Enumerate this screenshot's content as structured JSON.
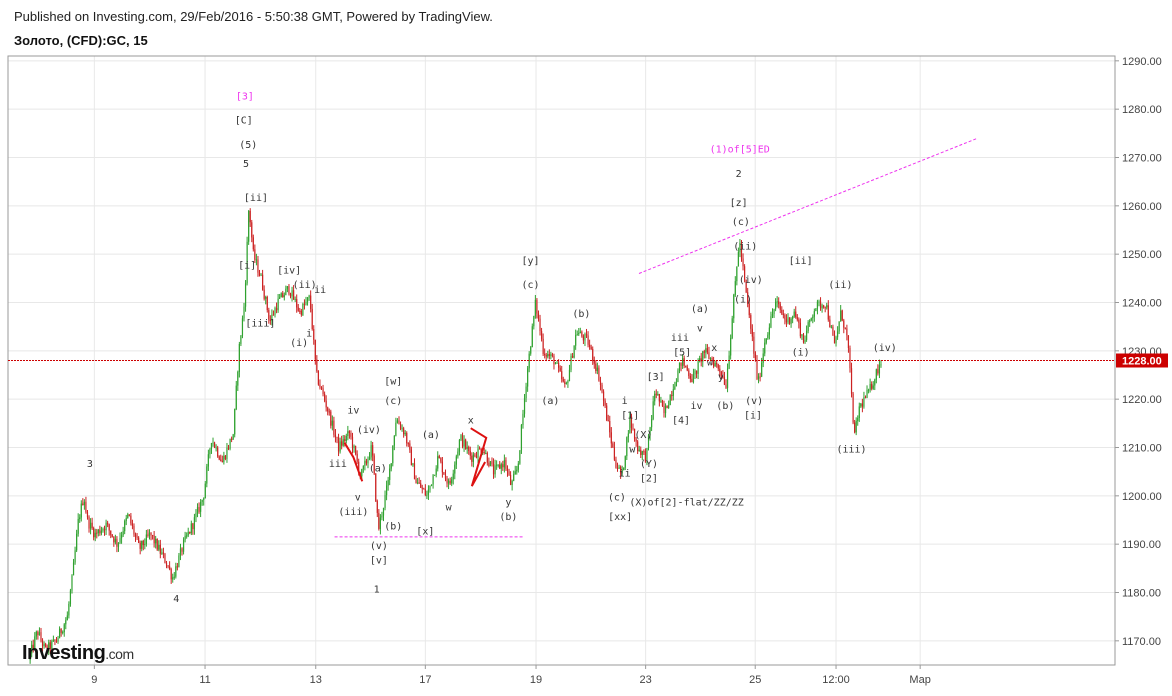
{
  "header": {
    "published": "Published on Investing.com, 29/Feb/2016 - 5:50:38 GMT, Powered by TradingView.",
    "symbol": "Золото, (CFD):GC, 15"
  },
  "logo": {
    "brand": "Investing",
    "suffix": ".com"
  },
  "colors": {
    "up": "#2fa12f",
    "down": "#cc2222",
    "price_line": "#cc0000",
    "wave_magenta": "#ee33ee",
    "grid": "#e8e8e8"
  },
  "chart_data": {
    "type": "candlestick",
    "ylim": [
      1165,
      1291
    ],
    "yticks": [
      1170,
      1180,
      1190,
      1200,
      1210,
      1220,
      1230,
      1240,
      1250,
      1260,
      1270,
      1280,
      1290
    ],
    "ytick_labels": [
      "1170.00",
      "1180.00",
      "1190.00",
      "1200.00",
      "1210.00",
      "1220.00",
      "1230.00",
      "1240.00",
      "1250.00",
      "1260.00",
      "1270.00",
      "1280.00",
      "1290.00"
    ],
    "xlim": [
      0,
      100
    ],
    "xticks": [
      7.8,
      17.8,
      27.8,
      37.7,
      47.7,
      57.6,
      67.5,
      74.8,
      82.4
    ],
    "xtick_labels": [
      "9",
      "11",
      "13",
      "17",
      "19",
      "23",
      "25",
      "12:00",
      "Мар"
    ],
    "current_price": 1228,
    "current_price_label": "1228.00",
    "price_path": [
      [
        2.0,
        1166
      ],
      [
        2.8,
        1172
      ],
      [
        3.5,
        1168
      ],
      [
        4.5,
        1170
      ],
      [
        5.5,
        1175
      ],
      [
        6.0,
        1184
      ],
      [
        6.5,
        1195
      ],
      [
        7.0,
        1200
      ],
      [
        7.3,
        1195
      ],
      [
        8.0,
        1192
      ],
      [
        9.0,
        1194
      ],
      [
        10.0,
        1190
      ],
      [
        11.0,
        1196
      ],
      [
        12.0,
        1189
      ],
      [
        13.0,
        1192
      ],
      [
        14.5,
        1186
      ],
      [
        15.0,
        1183
      ],
      [
        16.0,
        1190
      ],
      [
        17.0,
        1195
      ],
      [
        17.8,
        1200
      ],
      [
        18.5,
        1212
      ],
      [
        19.5,
        1207
      ],
      [
        20.5,
        1213
      ],
      [
        21.0,
        1230
      ],
      [
        21.5,
        1240
      ],
      [
        21.9,
        1260
      ],
      [
        22.3,
        1250
      ],
      [
        23.0,
        1245
      ],
      [
        23.8,
        1236
      ],
      [
        24.5,
        1240
      ],
      [
        25.5,
        1243
      ],
      [
        26.5,
        1238
      ],
      [
        27.4,
        1241
      ],
      [
        28.0,
        1225
      ],
      [
        29.0,
        1218
      ],
      [
        30.0,
        1210
      ],
      [
        31.0,
        1213
      ],
      [
        32.0,
        1204
      ],
      [
        33.0,
        1210
      ],
      [
        33.6,
        1193
      ],
      [
        34.5,
        1203
      ],
      [
        35.2,
        1216
      ],
      [
        36.0,
        1213
      ],
      [
        37.0,
        1203
      ],
      [
        38.0,
        1200
      ],
      [
        39.0,
        1208
      ],
      [
        40.0,
        1202
      ],
      [
        41.0,
        1212
      ],
      [
        42.0,
        1208
      ],
      [
        43.0,
        1210
      ],
      [
        44.0,
        1205
      ],
      [
        45.0,
        1207
      ],
      [
        45.6,
        1202
      ],
      [
        46.2,
        1206
      ],
      [
        47.0,
        1225
      ],
      [
        47.8,
        1240
      ],
      [
        48.5,
        1230
      ],
      [
        49.5,
        1228
      ],
      [
        50.5,
        1222
      ],
      [
        51.5,
        1234
      ],
      [
        52.5,
        1232
      ],
      [
        53.5,
        1225
      ],
      [
        55.0,
        1207
      ],
      [
        55.6,
        1204
      ],
      [
        56.3,
        1216
      ],
      [
        57.0,
        1210
      ],
      [
        57.8,
        1208
      ],
      [
        58.6,
        1222
      ],
      [
        59.4,
        1217
      ],
      [
        60.0,
        1221
      ],
      [
        61.0,
        1228
      ],
      [
        62.0,
        1224
      ],
      [
        63.0,
        1230
      ],
      [
        64.5,
        1226
      ],
      [
        65.0,
        1223
      ],
      [
        65.6,
        1238
      ],
      [
        66.2,
        1253
      ],
      [
        66.8,
        1242
      ],
      [
        67.4,
        1232
      ],
      [
        67.9,
        1223
      ],
      [
        68.5,
        1232
      ],
      [
        69.5,
        1240
      ],
      [
        70.5,
        1236
      ],
      [
        71.2,
        1238
      ],
      [
        72.0,
        1232
      ],
      [
        73.0,
        1239
      ],
      [
        74.0,
        1240
      ],
      [
        74.8,
        1231
      ],
      [
        75.4,
        1238
      ],
      [
        76.0,
        1232
      ],
      [
        76.6,
        1212
      ],
      [
        77.0,
        1218
      ],
      [
        78.0,
        1222
      ],
      [
        79.0,
        1228
      ]
    ],
    "trendlines": [
      {
        "x1": 29.5,
        "y1": 1191.5,
        "x2": 46.5,
        "y2": 1191.5
      },
      {
        "x1": 57.0,
        "y1": 1246,
        "x2": 87.6,
        "y2": 1274
      }
    ],
    "zigzags": [
      {
        "points": [
          [
            30.4,
            1211
          ],
          [
            31.2,
            1208
          ],
          [
            32.0,
            1203
          ]
        ]
      },
      {
        "points": [
          [
            41.8,
            1214
          ],
          [
            43.2,
            1212
          ],
          [
            41.9,
            1202
          ],
          [
            43.1,
            1207
          ]
        ]
      }
    ],
    "labels": [
      {
        "text": "3",
        "x": 7.4,
        "y": 1206,
        "color": "#333"
      },
      {
        "text": "4",
        "x": 15.2,
        "y": 1178,
        "color": "#333"
      },
      {
        "text": "[3]",
        "x": 21.4,
        "y": 1282,
        "color": "#ee33ee"
      },
      {
        "text": "[C]",
        "x": 21.3,
        "y": 1277,
        "color": "#333"
      },
      {
        "text": "(5)",
        "x": 21.7,
        "y": 1272,
        "color": "#333"
      },
      {
        "text": "5",
        "x": 21.5,
        "y": 1268,
        "color": "#333"
      },
      {
        "text": "[ii]",
        "x": 22.4,
        "y": 1261,
        "color": "#333"
      },
      {
        "text": "[i]",
        "x": 21.6,
        "y": 1247,
        "color": "#333"
      },
      {
        "text": "[iv]",
        "x": 25.4,
        "y": 1246,
        "color": "#333"
      },
      {
        "text": "(ii)",
        "x": 26.8,
        "y": 1243,
        "color": "#333"
      },
      {
        "text": "ii",
        "x": 28.2,
        "y": 1242,
        "color": "#333"
      },
      {
        "text": "[iii]",
        "x": 22.8,
        "y": 1235,
        "color": "#333"
      },
      {
        "text": "i",
        "x": 27.2,
        "y": 1233,
        "color": "#333"
      },
      {
        "text": "(i)",
        "x": 26.3,
        "y": 1231,
        "color": "#333"
      },
      {
        "text": "[w]",
        "x": 34.8,
        "y": 1223,
        "color": "#333"
      },
      {
        "text": "(c)",
        "x": 34.8,
        "y": 1219,
        "color": "#333"
      },
      {
        "text": "iv",
        "x": 31.2,
        "y": 1217,
        "color": "#333"
      },
      {
        "text": "(iv)",
        "x": 32.6,
        "y": 1213,
        "color": "#333"
      },
      {
        "text": "(a)",
        "x": 38.2,
        "y": 1212,
        "color": "#333"
      },
      {
        "text": "x",
        "x": 41.8,
        "y": 1215,
        "color": "#333"
      },
      {
        "text": "iii",
        "x": 29.8,
        "y": 1206,
        "color": "#333"
      },
      {
        "text": "(a)",
        "x": 33.4,
        "y": 1205,
        "color": "#333"
      },
      {
        "text": "v",
        "x": 31.6,
        "y": 1199,
        "color": "#333"
      },
      {
        "text": "w",
        "x": 39.8,
        "y": 1197,
        "color": "#333"
      },
      {
        "text": "y",
        "x": 45.2,
        "y": 1198,
        "color": "#333"
      },
      {
        "text": "(iii)",
        "x": 31.2,
        "y": 1196,
        "color": "#333"
      },
      {
        "text": "(b)",
        "x": 45.2,
        "y": 1195,
        "color": "#333"
      },
      {
        "text": "(b)",
        "x": 34.8,
        "y": 1193,
        "color": "#333"
      },
      {
        "text": "[x]",
        "x": 37.7,
        "y": 1192,
        "color": "#333"
      },
      {
        "text": "(v)",
        "x": 33.5,
        "y": 1189,
        "color": "#333"
      },
      {
        "text": "[v]",
        "x": 33.5,
        "y": 1186,
        "color": "#333"
      },
      {
        "text": "1",
        "x": 33.3,
        "y": 1180,
        "color": "#333"
      },
      {
        "text": "[y]",
        "x": 47.2,
        "y": 1248,
        "color": "#333"
      },
      {
        "text": "(c)",
        "x": 47.2,
        "y": 1243,
        "color": "#333"
      },
      {
        "text": "(b)",
        "x": 51.8,
        "y": 1237,
        "color": "#333"
      },
      {
        "text": "(a)",
        "x": 49.0,
        "y": 1219,
        "color": "#333"
      },
      {
        "text": "[1]",
        "x": 56.2,
        "y": 1216,
        "color": "#333"
      },
      {
        "text": "i",
        "x": 55.7,
        "y": 1219,
        "color": "#333"
      },
      {
        "text": "(X)",
        "x": 57.4,
        "y": 1212,
        "color": "#333"
      },
      {
        "text": "w",
        "x": 56.4,
        "y": 1209,
        "color": "#333"
      },
      {
        "text": "(Y)",
        "x": 57.9,
        "y": 1206,
        "color": "#333"
      },
      {
        "text": "ii",
        "x": 55.7,
        "y": 1204,
        "color": "#333"
      },
      {
        "text": "[2]",
        "x": 57.9,
        "y": 1203,
        "color": "#333"
      },
      {
        "text": "(c)",
        "x": 55.0,
        "y": 1199,
        "color": "#333"
      },
      {
        "text": "(X)of[2]-flat/ZZ/ZZ",
        "x": 61.3,
        "y": 1198,
        "color": "#333"
      },
      {
        "text": "[xx]",
        "x": 55.3,
        "y": 1195,
        "color": "#333"
      },
      {
        "text": "[3]",
        "x": 58.5,
        "y": 1224,
        "color": "#333"
      },
      {
        "text": "[4]",
        "x": 60.8,
        "y": 1215,
        "color": "#333"
      },
      {
        "text": "iii",
        "x": 60.7,
        "y": 1232,
        "color": "#333"
      },
      {
        "text": "[5]",
        "x": 60.9,
        "y": 1229,
        "color": "#333"
      },
      {
        "text": "(a)",
        "x": 62.5,
        "y": 1238,
        "color": "#333"
      },
      {
        "text": "v",
        "x": 62.5,
        "y": 1234,
        "color": "#333"
      },
      {
        "text": "x",
        "x": 63.8,
        "y": 1230,
        "color": "#333"
      },
      {
        "text": "w",
        "x": 63.4,
        "y": 1227,
        "color": "#333"
      },
      {
        "text": "y",
        "x": 64.4,
        "y": 1224,
        "color": "#333"
      },
      {
        "text": "iv",
        "x": 62.2,
        "y": 1218,
        "color": "#333"
      },
      {
        "text": "(b)",
        "x": 64.8,
        "y": 1218,
        "color": "#333"
      },
      {
        "text": "(1)of[5]ED",
        "x": 66.1,
        "y": 1271,
        "color": "#ee33ee"
      },
      {
        "text": "2",
        "x": 66.0,
        "y": 1266,
        "color": "#333"
      },
      {
        "text": "[z]",
        "x": 66.0,
        "y": 1260,
        "color": "#333"
      },
      {
        "text": "(c)",
        "x": 66.2,
        "y": 1256,
        "color": "#333"
      },
      {
        "text": "(ii)",
        "x": 66.6,
        "y": 1251,
        "color": "#333"
      },
      {
        "text": "(iv)",
        "x": 67.1,
        "y": 1244,
        "color": "#333"
      },
      {
        "text": "(i)",
        "x": 66.4,
        "y": 1240,
        "color": "#333"
      },
      {
        "text": "(v)",
        "x": 67.4,
        "y": 1219,
        "color": "#333"
      },
      {
        "text": "[i]",
        "x": 67.3,
        "y": 1216,
        "color": "#333"
      },
      {
        "text": "[ii]",
        "x": 71.6,
        "y": 1248,
        "color": "#333"
      },
      {
        "text": "(ii)",
        "x": 75.2,
        "y": 1243,
        "color": "#333"
      },
      {
        "text": "(i)",
        "x": 71.6,
        "y": 1229,
        "color": "#333"
      },
      {
        "text": "(iv)",
        "x": 79.2,
        "y": 1230,
        "color": "#333"
      },
      {
        "text": "(iii)",
        "x": 76.2,
        "y": 1209,
        "color": "#333"
      }
    ]
  }
}
